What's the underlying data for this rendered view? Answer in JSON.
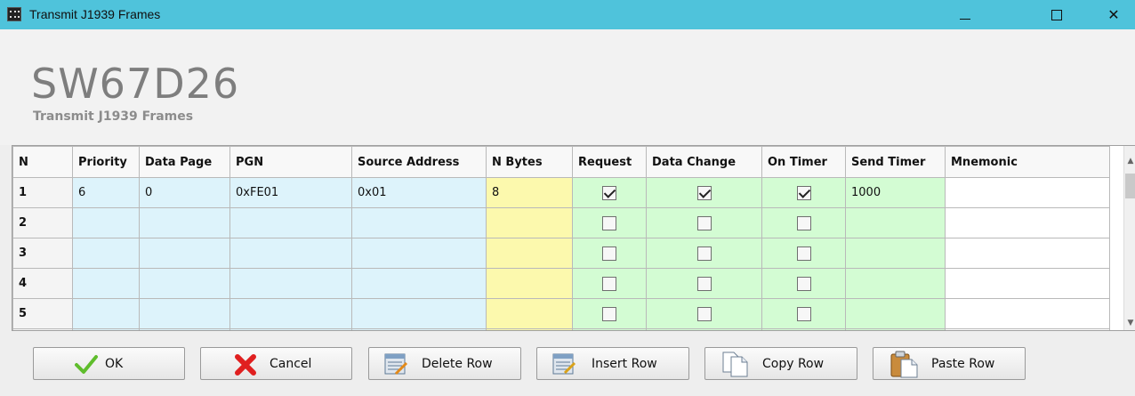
{
  "window": {
    "title": "Transmit J1939 Frames",
    "minimize": "—",
    "maximize": "☐",
    "close": "✕"
  },
  "header": {
    "code": "SW67D26",
    "subtitle": "Transmit J1939 Frames"
  },
  "table": {
    "columns": [
      "N",
      "Priority",
      "Data Page",
      "PGN",
      "Source Address",
      "N Bytes",
      "Request",
      "Data Change",
      "On Timer",
      "Send Timer",
      "Mnemonic"
    ],
    "rows": [
      {
        "n": "1",
        "priority": "6",
        "data_page": "0",
        "pgn": "0xFE01",
        "source_address": "0x01",
        "n_bytes": "8",
        "request": true,
        "data_change": true,
        "on_timer": true,
        "send_timer": "1000",
        "mnemonic": ""
      },
      {
        "n": "2",
        "priority": "",
        "data_page": "",
        "pgn": "",
        "source_address": "",
        "n_bytes": "",
        "request": false,
        "data_change": false,
        "on_timer": false,
        "send_timer": "",
        "mnemonic": ""
      },
      {
        "n": "3",
        "priority": "",
        "data_page": "",
        "pgn": "",
        "source_address": "",
        "n_bytes": "",
        "request": false,
        "data_change": false,
        "on_timer": false,
        "send_timer": "",
        "mnemonic": ""
      },
      {
        "n": "4",
        "priority": "",
        "data_page": "",
        "pgn": "",
        "source_address": "",
        "n_bytes": "",
        "request": false,
        "data_change": false,
        "on_timer": false,
        "send_timer": "",
        "mnemonic": ""
      },
      {
        "n": "5",
        "priority": "",
        "data_page": "",
        "pgn": "",
        "source_address": "",
        "n_bytes": "",
        "request": false,
        "data_change": false,
        "on_timer": false,
        "send_timer": "",
        "mnemonic": ""
      },
      {
        "n": "",
        "priority": "",
        "data_page": "",
        "pgn": "",
        "source_address": "",
        "n_bytes": "",
        "request": false,
        "data_change": false,
        "on_timer": false,
        "send_timer": "",
        "mnemonic": ""
      }
    ]
  },
  "buttons": {
    "ok": "OK",
    "cancel": "Cancel",
    "delete_row": "Delete Row",
    "insert_row": "Insert Row",
    "copy_row": "Copy Row",
    "paste_row": "Paste Row"
  },
  "colors": {
    "titlebar": "#4fc3db",
    "blue_cells": "#ddf3fb",
    "yellow_cells": "#fcf9ad",
    "green_cells": "#d3fcd3"
  },
  "icons": {
    "app": "adfweb-icon",
    "ok": "checkmark-icon",
    "cancel": "red-x-icon",
    "delete_row": "delete-row-icon",
    "insert_row": "insert-row-icon",
    "copy_row": "copy-document-icon",
    "paste_row": "paste-clipboard-icon"
  }
}
